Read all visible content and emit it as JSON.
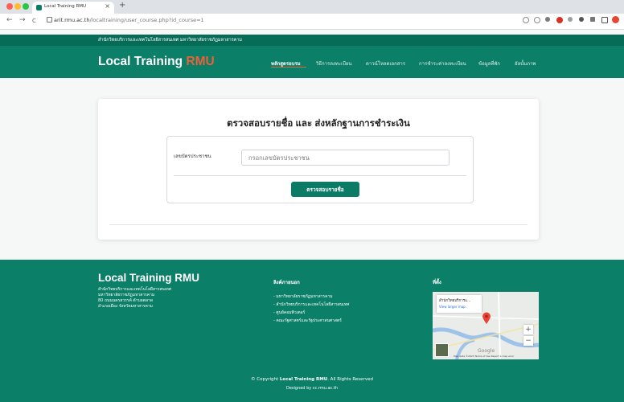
{
  "browser": {
    "tab_title": "Local Training RMU",
    "tab_close": "×",
    "new_tab": "+",
    "url_host": "arit.rmu.ac.th",
    "url_path": "/localtraining/user_course.php?id_course=1",
    "nav_back": "←",
    "nav_forward": "→",
    "nav_reload": "C"
  },
  "site": {
    "top_strip": "สำนักวิทยบริการและเทคโนโลยีสารสนเทศ มหาวิทยาลัยราชภัฏมหาสารคาม",
    "brand_main": "Local Training ",
    "brand_accent": "RMU",
    "nav": [
      {
        "label": "หลักสูตรอบรม",
        "active": true
      },
      {
        "label": "วิธีการลงทะเบียน",
        "active": false
      },
      {
        "label": "ดาวน์โหลดเอกสาร",
        "active": false
      },
      {
        "label": "การชำระค่าลงทะเบียน",
        "active": false
      },
      {
        "label": "ข้อมูลที่พัก",
        "active": false
      },
      {
        "label": "อัลบั้มภาพ",
        "active": false
      }
    ]
  },
  "form": {
    "title": "ตรวจสอบรายชื่อ และ ส่งหลักฐานการชำระเงิน",
    "id_label": "เลขบัตรประชาชน",
    "id_placeholder": "กรอกเลขบัตรประชาชน",
    "submit_label": "ตรวจสอบรายชื่อ"
  },
  "footer": {
    "title": "Local Training RMU",
    "address": [
      "สำนักวิทยบริการและเทคโนโลยีสารสนเทศ",
      "มหาวิทยาลัยราชภัฏมหาสารคาม",
      "80 ถนนนครสวรรค์ ตำบลตลาด",
      "อำเภอเมือง จังหวัดมหาสารคาม"
    ],
    "links_heading": "ลิงค์ภายนอก",
    "links": [
      "- มหาวิทยาลัยราชภัฏมหาสารคาม",
      "- สำนักวิทยบริการและเทคโนโลยีสารสนเทศ",
      "- ศูนย์คอมพิวเตอร์",
      "- คณะรัฐศาสตร์และรัฐประศาสนศาสตร์"
    ],
    "location_heading": "ที่ตั้ง",
    "map_place": "สำนักวิทยบริการแ...",
    "map_link": "View larger map",
    "map_attribution": "Map data ©2023   Terms of Use   Report a map error",
    "map_logo": "Google",
    "copyright_prefix": "© Copyright ",
    "copyright_brand": "Local Training RMU",
    "copyright_suffix": ". All Rights Reserved",
    "designed": "Designed by cc.rmu.ac.th"
  },
  "colors": {
    "brand_green": "#0b7f68",
    "dark_green": "#066b57",
    "accent_orange": "#e8623a"
  }
}
